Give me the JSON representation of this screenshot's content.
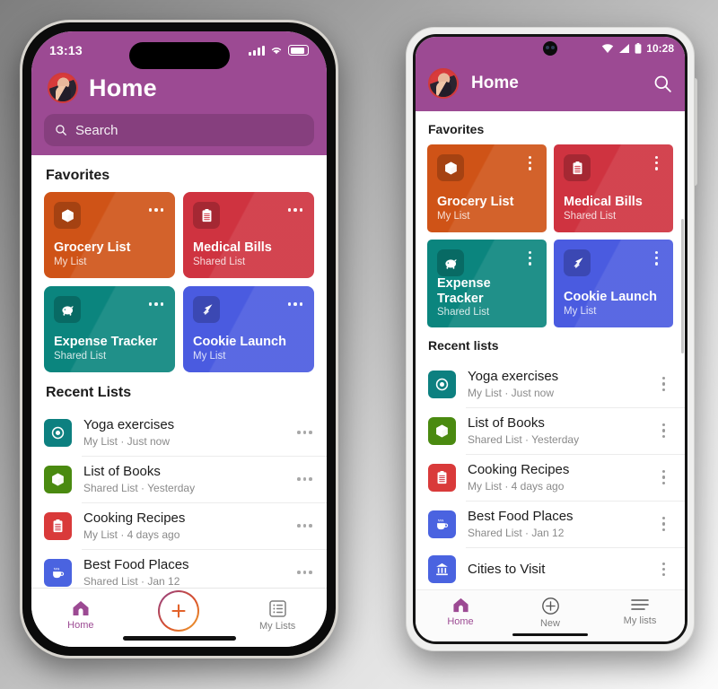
{
  "app": {
    "title": "Home"
  },
  "iphone": {
    "status": {
      "time": "13:13",
      "signal_icon": "cellular-bars-icon",
      "wifi_icon": "wifi-icon",
      "battery_icon": "battery-icon"
    },
    "header": {
      "title": "Home",
      "avatar_icon": "user-avatar",
      "search_placeholder": "Search",
      "search_icon": "search-icon"
    },
    "favorites_title": "Favorites",
    "recent_title": "Recent Lists",
    "favorites": [
      {
        "name": "Grocery List",
        "sub": "My List",
        "color": "#cf5317",
        "icon": "box-icon"
      },
      {
        "name": "Medical Bills",
        "sub": "Shared List",
        "color": "#cf3340",
        "icon": "clipboard-icon"
      },
      {
        "name": "Expense Tracker",
        "sub": "Shared List",
        "color": "#0b857e",
        "icon": "piggy-bank-icon"
      },
      {
        "name": "Cookie Launch",
        "sub": "My List",
        "color": "#4a5be0",
        "icon": "rocket-icon"
      }
    ],
    "recent": [
      {
        "name": "Yoga exercises",
        "sub": "My List · Just now",
        "color": "#0d8080",
        "icon": "target-icon"
      },
      {
        "name": "List of Books",
        "sub": "Shared List · Yesterday",
        "color": "#4a8a10",
        "icon": "box-icon"
      },
      {
        "name": "Cooking Recipes",
        "sub": "My List · 4 days ago",
        "color": "#d93a3a",
        "icon": "clipboard-icon"
      },
      {
        "name": "Best Food Places",
        "sub": "Shared List · Jan 12",
        "color": "#4a63e0",
        "icon": "coffee-icon"
      }
    ],
    "tabs": [
      {
        "label": "Home",
        "icon": "home-icon",
        "active": true
      },
      {
        "label": "",
        "icon": "plus-icon",
        "active": false
      },
      {
        "label": "My Lists",
        "icon": "list-icon",
        "active": false
      }
    ]
  },
  "android": {
    "status": {
      "time": "10:28",
      "wifi_icon": "wifi-icon",
      "signal_icon": "signal-icon",
      "battery_icon": "battery-icon"
    },
    "header": {
      "title": "Home",
      "avatar_icon": "user-avatar",
      "search_icon": "search-icon"
    },
    "favorites_title": "Favorites",
    "recent_title": "Recent lists",
    "favorites": [
      {
        "name": "Grocery List",
        "sub": "My List",
        "color": "#cf5317",
        "icon": "box-icon"
      },
      {
        "name": "Medical Bills",
        "sub": "Shared List",
        "color": "#cf3340",
        "icon": "clipboard-icon"
      },
      {
        "name": "Expense Tracker",
        "sub": "Shared List",
        "color": "#0b857e",
        "icon": "piggy-bank-icon"
      },
      {
        "name": "Cookie Launch",
        "sub": "My List",
        "color": "#4a5be0",
        "icon": "rocket-icon"
      }
    ],
    "recent": [
      {
        "name": "Yoga exercises",
        "sub": "My List · Just now",
        "color": "#0d8080",
        "icon": "target-icon"
      },
      {
        "name": "List of Books",
        "sub": "Shared List · Yesterday",
        "color": "#4a8a10",
        "icon": "box-icon"
      },
      {
        "name": "Cooking Recipes",
        "sub": "My List · 4 days ago",
        "color": "#d93a3a",
        "icon": "clipboard-icon"
      },
      {
        "name": "Best Food Places",
        "sub": "Shared List · Jan 12",
        "color": "#4a63e0",
        "icon": "coffee-icon"
      },
      {
        "name": "Cities to Visit",
        "sub": "",
        "color": "#4a63e0",
        "icon": "landmark-icon"
      }
    ],
    "nav": [
      {
        "label": "Home",
        "icon": "home-icon",
        "active": true
      },
      {
        "label": "New",
        "icon": "plus-circle-icon",
        "active": false
      },
      {
        "label": "My lists",
        "icon": "menu-icon",
        "active": false
      }
    ]
  },
  "theme": {
    "accent": "#9c4a93",
    "surface": "#ffffff",
    "muted": "#8a8a8a"
  }
}
